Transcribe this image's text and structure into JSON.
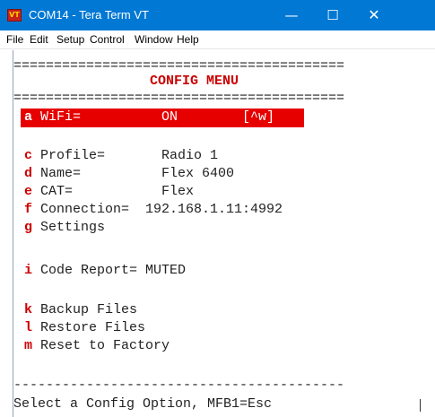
{
  "window": {
    "title": "COM14 - Tera Term VT",
    "icon_label": "VT",
    "minimize": "—",
    "maximize": "☐",
    "close": "✕"
  },
  "menu": [
    "File",
    "Edit",
    "Setup",
    "Control",
    "Window",
    "Help"
  ],
  "terminal": {
    "separator_top": "=========================================",
    "heading": "CONFIG MENU",
    "separator_mid": "=========================================",
    "options": [
      {
        "key": "a",
        "text": " WiFi=          ON        [^w]",
        "highlighted": true
      },
      {
        "key": "c",
        "text": " Profile=       Radio 1"
      },
      {
        "key": "d",
        "text": " Name=          Flex 6400"
      },
      {
        "key": "e",
        "text": " CAT=           Flex"
      },
      {
        "key": "f",
        "text": " Connection=  192.168.1.11:4992"
      },
      {
        "key": "g",
        "text": " Settings"
      },
      {
        "key": "i",
        "text": " Code Report= MUTED"
      },
      {
        "key": "k",
        "text": " Backup Files"
      },
      {
        "key": "l",
        "text": " Restore Files"
      },
      {
        "key": "m",
        "text": " Reset to Factory"
      }
    ],
    "separator_bottom": "-----------------------------------------",
    "prompt": "Select a Config Option, MFB1=Esc"
  },
  "colors": {
    "title_bar": "#0078d4",
    "highlight": "#e60000",
    "key": "#cc0000"
  }
}
